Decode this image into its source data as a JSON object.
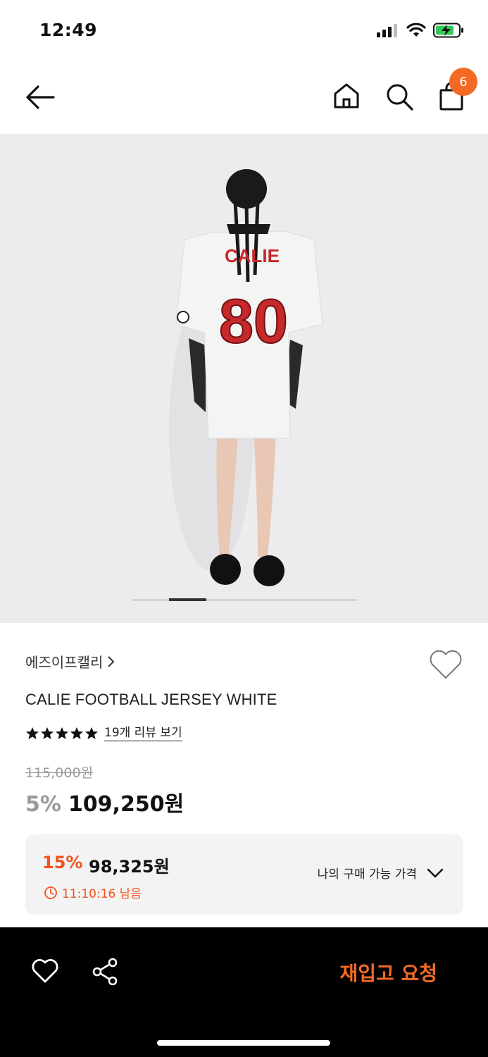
{
  "status_bar": {
    "time": "12:49"
  },
  "nav": {
    "cart_count": "6"
  },
  "product": {
    "brand": "에즈이프캘리",
    "title": "CALIE FOOTBALL JERSEY WHITE",
    "image_alt_visible_text": {
      "name": "CALIE",
      "number": "80"
    },
    "rating_stars": 5,
    "review_link": "19개 리뷰 보기",
    "original_price": "115,000원",
    "discount_rate": "5%",
    "sale_price": "109,250원",
    "image_pager": {
      "current": 2,
      "total": 6
    }
  },
  "coupon": {
    "rate": "15%",
    "price": "98,325원",
    "timer": "11:10:16 남음",
    "my_price_label": "나의 구매 가능 가격"
  },
  "bottom_bar": {
    "restock_label": "재입고 요청"
  },
  "colors": {
    "accent": "#f46a25",
    "coupon_red": "#f2531d",
    "image_bg": "#ececee",
    "jersey_red": "#c7282b",
    "battery_green": "#34c759"
  }
}
